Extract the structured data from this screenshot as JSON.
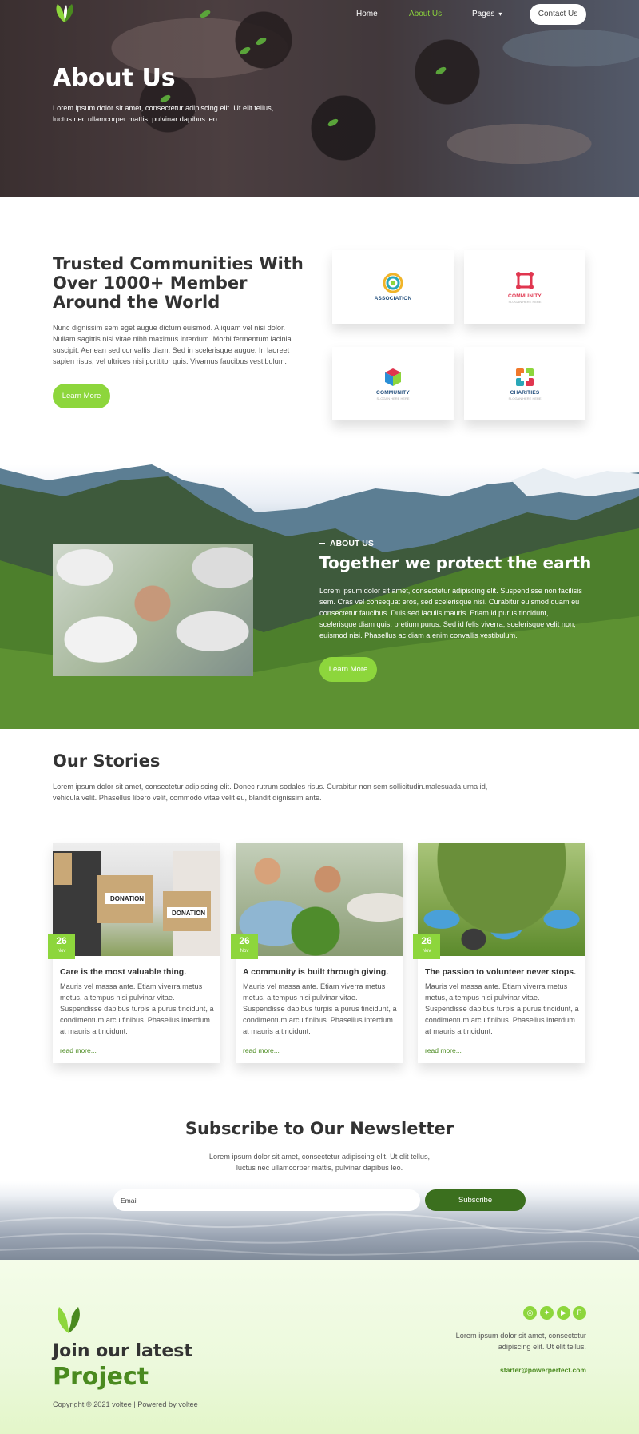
{
  "nav": {
    "home": "Home",
    "about": "About Us",
    "pages": "Pages",
    "contact_button": "Contact Us"
  },
  "hero": {
    "title": "About Us",
    "subtitle": "Lorem ipsum dolor sit amet, consectetur adipiscing elit. Ut elit tellus, luctus nec ullamcorper mattis, pulvinar dapibus leo."
  },
  "trusted": {
    "title": "Trusted Communities With Over 1000+ Member Around the World",
    "text": "Nunc dignissim sem eget augue dictum euismod. Aliquam vel nisi dolor. Nullam sagittis nisi vitae nibh maximus interdum. Morbi fermentum lacinia suscipit. Aenean sed convallis diam. Sed in scelerisque augue. In laoreet sapien risus, vel ultrices nisi porttitor quis. Vivamus faucibus vestibulum.",
    "button": "Learn More",
    "logos": [
      {
        "name": "ASSOCIATION",
        "tag": ""
      },
      {
        "name": "COMMUNITY",
        "tag": "SLOGAN HERE HERE"
      },
      {
        "name": "COMMUNITY",
        "tag": "SLOGAN HERE HERE"
      },
      {
        "name": "CHARITIES",
        "tag": "SLOGAN HERE HERE"
      }
    ]
  },
  "earth": {
    "kicker": "ABOUT US",
    "title": "Together we protect the earth",
    "text": "Lorem ipsum dolor sit amet, consectetur adipiscing elit. Suspendisse non facilisis sem. Cras vel consequat eros, sed scelerisque nisi. Curabitur euismod quam eu consectetur faucibus. Duis sed iaculis mauris. Etiam id purus tincidunt, scelerisque diam quis, pretium purus. Sed id felis viverra, scelerisque velit non, euismod nisi. Phasellus ac diam a enim convallis vestibulum.",
    "button": "Learn More"
  },
  "stories": {
    "title": "Our Stories",
    "text": "Lorem ipsum dolor sit amet, consectetur adipiscing elit. Donec rutrum sodales risus. Curabitur non sem sollicitudin.malesuada urna id, vehicula velit. Phasellus libero velit, commodo vitae velit eu, blandit dignissim ante.",
    "cards": [
      {
        "day": "26",
        "month": "Nov",
        "title": "Care is the most valuable thing.",
        "text": "Mauris vel massa ante. Etiam viverra metus metus, a tempus nisi pulvinar vitae. Suspendisse dapibus turpis a purus tincidunt, a condimentum arcu finibus. Phasellus interdum at mauris a tincidunt.",
        "link": "read more...",
        "box_label": "DONATION"
      },
      {
        "day": "26",
        "month": "Nov",
        "title": "A community is built through giving.",
        "text": "Mauris vel massa ante. Etiam viverra metus metus, a tempus nisi pulvinar vitae. Suspendisse dapibus turpis a purus tincidunt, a condimentum arcu finibus. Phasellus interdum at mauris a tincidunt.",
        "link": "read more..."
      },
      {
        "day": "26",
        "month": "Nov",
        "title": "The passion to volunteer never stops.",
        "text": "Mauris vel massa ante. Etiam viverra metus metus, a tempus nisi pulvinar vitae. Suspendisse dapibus turpis a purus tincidunt, a condimentum arcu finibus. Phasellus interdum at mauris a tincidunt.",
        "link": "read more..."
      }
    ]
  },
  "newsletter": {
    "title": "Subscribe to Our Newsletter",
    "text": "Lorem ipsum dolor sit amet, consectetur adipiscing elit. Ut elit tellus, luctus nec ullamcorper mattis, pulvinar dapibus leo.",
    "email_placeholder": "Email",
    "button": "Subscribe"
  },
  "footer": {
    "line1": "Join our latest",
    "line2": "Project",
    "copyright": "Copyright © 2021 voltee | Powered by voltee",
    "text": "Lorem ipsum dolor sit amet, consectetur adipiscing elit. Ut elit tellus.",
    "email": "starter@powerperfect.com",
    "social_icons": [
      "dribbble-icon",
      "twitter-icon",
      "youtube-icon",
      "pinterest-icon"
    ]
  },
  "colors": {
    "accent": "#8dd63c",
    "dark_green": "#3b6f1e",
    "link_green": "#4a8a1f"
  }
}
